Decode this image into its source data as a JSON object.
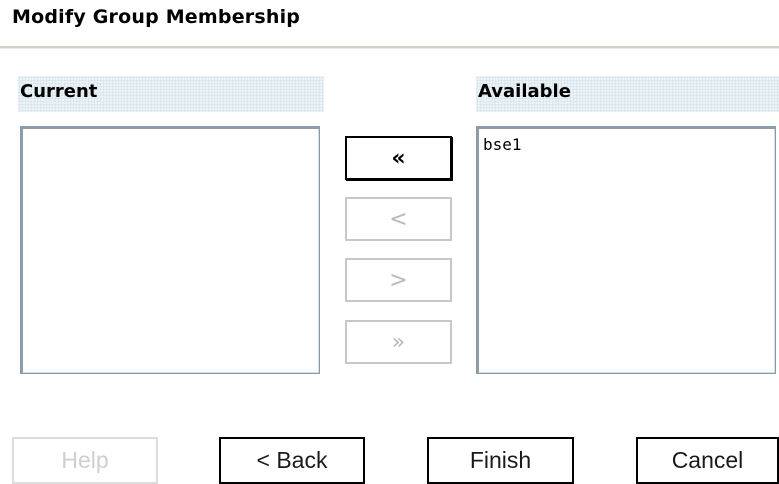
{
  "dialog": {
    "title": "Modify Group Membership"
  },
  "current": {
    "header": "Current",
    "items": []
  },
  "available": {
    "header": "Available",
    "items": [
      "bse1"
    ]
  },
  "move_buttons": {
    "add_all_label": "«",
    "add_label": "<",
    "remove_label": ">",
    "remove_all_label": "»"
  },
  "footer": {
    "help_label": "Help",
    "back_label": "< Back",
    "finish_label": "Finish",
    "cancel_label": "Cancel"
  }
}
